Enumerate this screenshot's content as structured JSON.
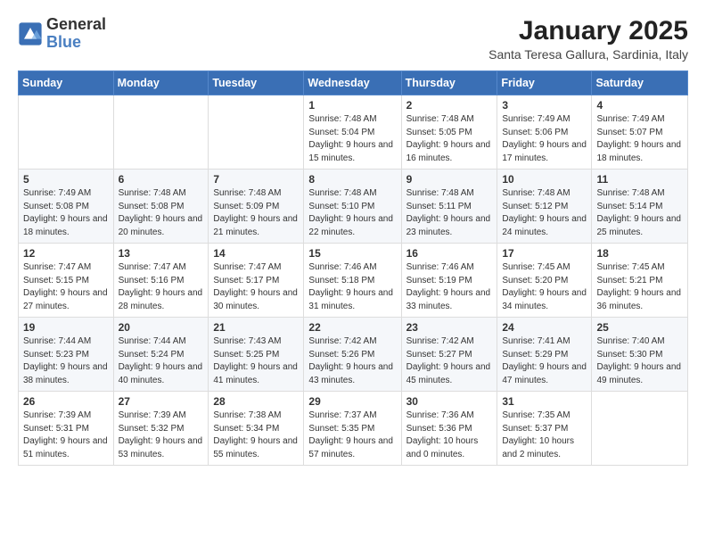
{
  "logo": {
    "general": "General",
    "blue": "Blue"
  },
  "header": {
    "month": "January 2025",
    "location": "Santa Teresa Gallura, Sardinia, Italy"
  },
  "weekdays": [
    "Sunday",
    "Monday",
    "Tuesday",
    "Wednesday",
    "Thursday",
    "Friday",
    "Saturday"
  ],
  "weeks": [
    [
      {
        "day": "",
        "sunrise": "",
        "sunset": "",
        "daylight": ""
      },
      {
        "day": "",
        "sunrise": "",
        "sunset": "",
        "daylight": ""
      },
      {
        "day": "",
        "sunrise": "",
        "sunset": "",
        "daylight": ""
      },
      {
        "day": "1",
        "sunrise": "Sunrise: 7:48 AM",
        "sunset": "Sunset: 5:04 PM",
        "daylight": "Daylight: 9 hours and 15 minutes."
      },
      {
        "day": "2",
        "sunrise": "Sunrise: 7:48 AM",
        "sunset": "Sunset: 5:05 PM",
        "daylight": "Daylight: 9 hours and 16 minutes."
      },
      {
        "day": "3",
        "sunrise": "Sunrise: 7:49 AM",
        "sunset": "Sunset: 5:06 PM",
        "daylight": "Daylight: 9 hours and 17 minutes."
      },
      {
        "day": "4",
        "sunrise": "Sunrise: 7:49 AM",
        "sunset": "Sunset: 5:07 PM",
        "daylight": "Daylight: 9 hours and 18 minutes."
      }
    ],
    [
      {
        "day": "5",
        "sunrise": "Sunrise: 7:49 AM",
        "sunset": "Sunset: 5:08 PM",
        "daylight": "Daylight: 9 hours and 18 minutes."
      },
      {
        "day": "6",
        "sunrise": "Sunrise: 7:48 AM",
        "sunset": "Sunset: 5:08 PM",
        "daylight": "Daylight: 9 hours and 20 minutes."
      },
      {
        "day": "7",
        "sunrise": "Sunrise: 7:48 AM",
        "sunset": "Sunset: 5:09 PM",
        "daylight": "Daylight: 9 hours and 21 minutes."
      },
      {
        "day": "8",
        "sunrise": "Sunrise: 7:48 AM",
        "sunset": "Sunset: 5:10 PM",
        "daylight": "Daylight: 9 hours and 22 minutes."
      },
      {
        "day": "9",
        "sunrise": "Sunrise: 7:48 AM",
        "sunset": "Sunset: 5:11 PM",
        "daylight": "Daylight: 9 hours and 23 minutes."
      },
      {
        "day": "10",
        "sunrise": "Sunrise: 7:48 AM",
        "sunset": "Sunset: 5:12 PM",
        "daylight": "Daylight: 9 hours and 24 minutes."
      },
      {
        "day": "11",
        "sunrise": "Sunrise: 7:48 AM",
        "sunset": "Sunset: 5:14 PM",
        "daylight": "Daylight: 9 hours and 25 minutes."
      }
    ],
    [
      {
        "day": "12",
        "sunrise": "Sunrise: 7:47 AM",
        "sunset": "Sunset: 5:15 PM",
        "daylight": "Daylight: 9 hours and 27 minutes."
      },
      {
        "day": "13",
        "sunrise": "Sunrise: 7:47 AM",
        "sunset": "Sunset: 5:16 PM",
        "daylight": "Daylight: 9 hours and 28 minutes."
      },
      {
        "day": "14",
        "sunrise": "Sunrise: 7:47 AM",
        "sunset": "Sunset: 5:17 PM",
        "daylight": "Daylight: 9 hours and 30 minutes."
      },
      {
        "day": "15",
        "sunrise": "Sunrise: 7:46 AM",
        "sunset": "Sunset: 5:18 PM",
        "daylight": "Daylight: 9 hours and 31 minutes."
      },
      {
        "day": "16",
        "sunrise": "Sunrise: 7:46 AM",
        "sunset": "Sunset: 5:19 PM",
        "daylight": "Daylight: 9 hours and 33 minutes."
      },
      {
        "day": "17",
        "sunrise": "Sunrise: 7:45 AM",
        "sunset": "Sunset: 5:20 PM",
        "daylight": "Daylight: 9 hours and 34 minutes."
      },
      {
        "day": "18",
        "sunrise": "Sunrise: 7:45 AM",
        "sunset": "Sunset: 5:21 PM",
        "daylight": "Daylight: 9 hours and 36 minutes."
      }
    ],
    [
      {
        "day": "19",
        "sunrise": "Sunrise: 7:44 AM",
        "sunset": "Sunset: 5:23 PM",
        "daylight": "Daylight: 9 hours and 38 minutes."
      },
      {
        "day": "20",
        "sunrise": "Sunrise: 7:44 AM",
        "sunset": "Sunset: 5:24 PM",
        "daylight": "Daylight: 9 hours and 40 minutes."
      },
      {
        "day": "21",
        "sunrise": "Sunrise: 7:43 AM",
        "sunset": "Sunset: 5:25 PM",
        "daylight": "Daylight: 9 hours and 41 minutes."
      },
      {
        "day": "22",
        "sunrise": "Sunrise: 7:42 AM",
        "sunset": "Sunset: 5:26 PM",
        "daylight": "Daylight: 9 hours and 43 minutes."
      },
      {
        "day": "23",
        "sunrise": "Sunrise: 7:42 AM",
        "sunset": "Sunset: 5:27 PM",
        "daylight": "Daylight: 9 hours and 45 minutes."
      },
      {
        "day": "24",
        "sunrise": "Sunrise: 7:41 AM",
        "sunset": "Sunset: 5:29 PM",
        "daylight": "Daylight: 9 hours and 47 minutes."
      },
      {
        "day": "25",
        "sunrise": "Sunrise: 7:40 AM",
        "sunset": "Sunset: 5:30 PM",
        "daylight": "Daylight: 9 hours and 49 minutes."
      }
    ],
    [
      {
        "day": "26",
        "sunrise": "Sunrise: 7:39 AM",
        "sunset": "Sunset: 5:31 PM",
        "daylight": "Daylight: 9 hours and 51 minutes."
      },
      {
        "day": "27",
        "sunrise": "Sunrise: 7:39 AM",
        "sunset": "Sunset: 5:32 PM",
        "daylight": "Daylight: 9 hours and 53 minutes."
      },
      {
        "day": "28",
        "sunrise": "Sunrise: 7:38 AM",
        "sunset": "Sunset: 5:34 PM",
        "daylight": "Daylight: 9 hours and 55 minutes."
      },
      {
        "day": "29",
        "sunrise": "Sunrise: 7:37 AM",
        "sunset": "Sunset: 5:35 PM",
        "daylight": "Daylight: 9 hours and 57 minutes."
      },
      {
        "day": "30",
        "sunrise": "Sunrise: 7:36 AM",
        "sunset": "Sunset: 5:36 PM",
        "daylight": "Daylight: 10 hours and 0 minutes."
      },
      {
        "day": "31",
        "sunrise": "Sunrise: 7:35 AM",
        "sunset": "Sunset: 5:37 PM",
        "daylight": "Daylight: 10 hours and 2 minutes."
      },
      {
        "day": "",
        "sunrise": "",
        "sunset": "",
        "daylight": ""
      }
    ]
  ]
}
